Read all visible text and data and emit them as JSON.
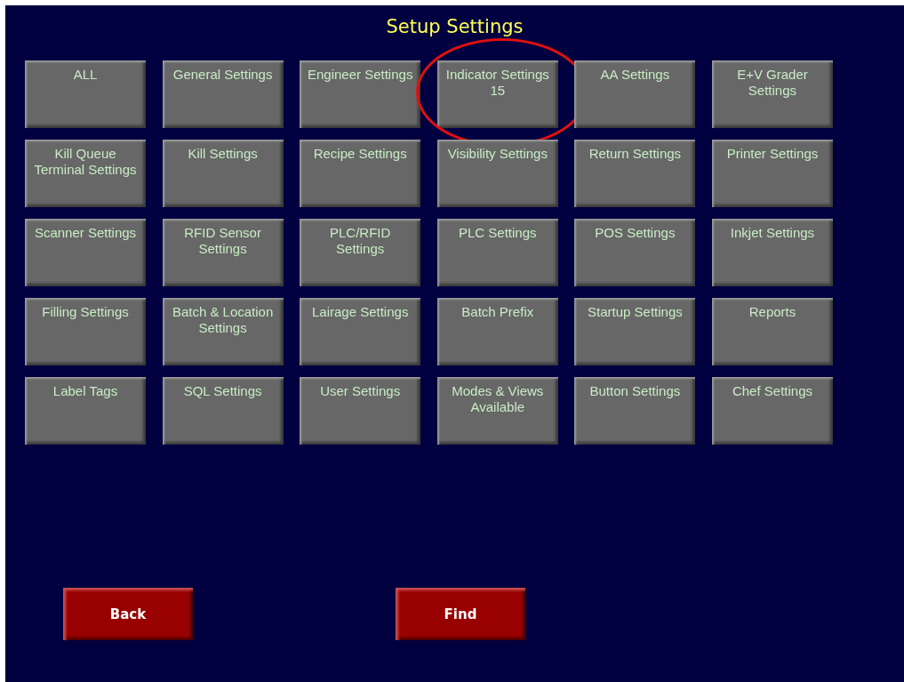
{
  "window": {
    "title": "Setup Settings"
  },
  "buttons": [
    {
      "label": "ALL",
      "circled": false
    },
    {
      "label": "General Settings",
      "circled": false
    },
    {
      "label": "Engineer Settings",
      "circled": false
    },
    {
      "label": "Indicator Settings\n15",
      "circled": true
    },
    {
      "label": "AA Settings",
      "circled": false
    },
    {
      "label": "E+V Grader\nSettings",
      "circled": false
    },
    {
      "label": "Kill Queue\nTerminal Settings",
      "circled": false
    },
    {
      "label": "Kill Settings",
      "circled": false
    },
    {
      "label": "Recipe Settings",
      "circled": false
    },
    {
      "label": "Visibility Settings",
      "circled": false
    },
    {
      "label": "Return Settings",
      "circled": false
    },
    {
      "label": "Printer Settings",
      "circled": false
    },
    {
      "label": "Scanner Settings",
      "circled": false
    },
    {
      "label": "RFID Sensor\nSettings",
      "circled": false
    },
    {
      "label": "PLC/RFID\nSettings",
      "circled": false
    },
    {
      "label": "PLC Settings",
      "circled": false
    },
    {
      "label": "POS Settings",
      "circled": false
    },
    {
      "label": "Inkjet Settings",
      "circled": false
    },
    {
      "label": "Filling Settings",
      "circled": false
    },
    {
      "label": "Batch & Location\nSettings",
      "circled": false
    },
    {
      "label": "Lairage Settings",
      "circled": false
    },
    {
      "label": "Batch Prefix",
      "circled": false
    },
    {
      "label": "Startup Settings",
      "circled": false
    },
    {
      "label": "Reports",
      "circled": false
    },
    {
      "label": "Label Tags",
      "circled": false
    },
    {
      "label": "SQL Settings",
      "circled": false
    },
    {
      "label": "User Settings",
      "circled": false
    },
    {
      "label": "Modes & Views\nAvailable",
      "circled": false
    },
    {
      "label": "Button Settings",
      "circled": false
    },
    {
      "label": "Chef Settings",
      "circled": false
    }
  ],
  "actions": [
    {
      "label": "Back"
    },
    {
      "label": "Find"
    }
  ]
}
